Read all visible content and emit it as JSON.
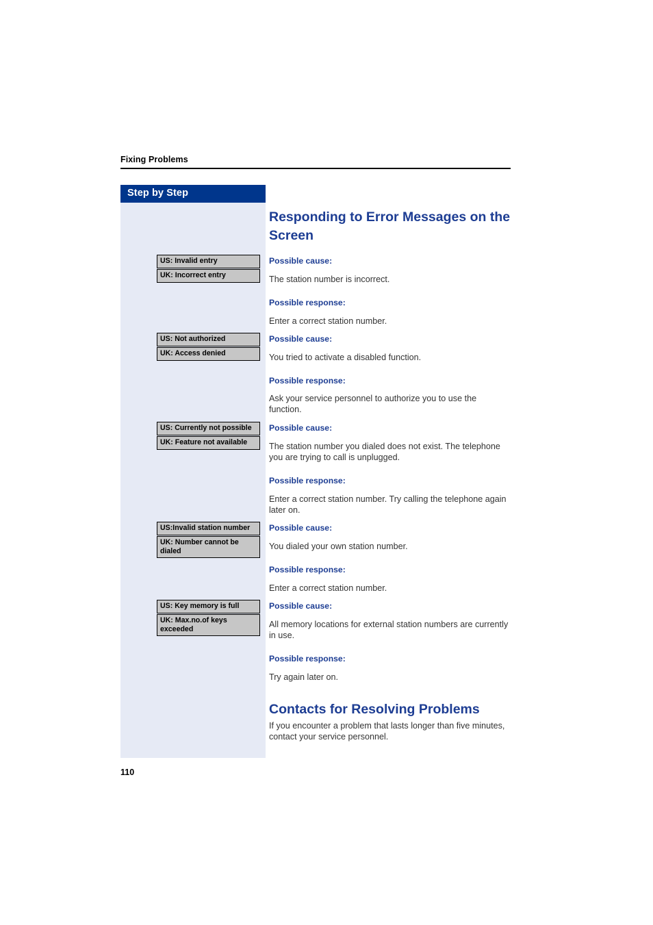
{
  "page": {
    "running_head": "Fixing Problems",
    "page_number": "110",
    "accent_blue": "#1d3d93",
    "title_bar_blue": "#00368c",
    "sidebar_bg": "#e6eaf5",
    "message_box_bg": "#c6c6c6"
  },
  "sidebar": {
    "title": "Step by Step"
  },
  "labels": {
    "cause": "Possible cause:",
    "response": "Possible response:"
  },
  "headings": {
    "error_messages": "Responding to Error Messages on the Screen",
    "contacts": "Contacts for Resolving Problems"
  },
  "messages": [
    {
      "us": "US: Invalid entry",
      "uk": "UK: Incorrect entry",
      "cause": "The station number is incorrect.",
      "response": "Enter a correct station number."
    },
    {
      "us": "US: Not authorized",
      "uk": "UK: Access denied",
      "cause": "You tried to activate a disabled function.",
      "response": "Ask your service personnel to authorize you to use the function."
    },
    {
      "us": "US: Currently not possible",
      "uk": "UK: Feature not available",
      "cause": "The station number you dialed does not exist. The telephone you are trying to call is unplugged.",
      "response": "Enter a correct station number. Try calling the telephone again later on."
    },
    {
      "us": "US:Invalid station number",
      "uk": "UK: Number cannot be dialed",
      "cause": "You dialed your own station number.",
      "response": "Enter a correct station number."
    },
    {
      "us": "US: Key memory is full",
      "uk": "UK: Max.no.of keys exceeded",
      "cause": "All memory locations for external station numbers are currently in use.",
      "response": "Try again later on."
    }
  ],
  "contacts": {
    "body": "If you encounter a problem that lasts longer than five minutes, contact your service personnel."
  }
}
